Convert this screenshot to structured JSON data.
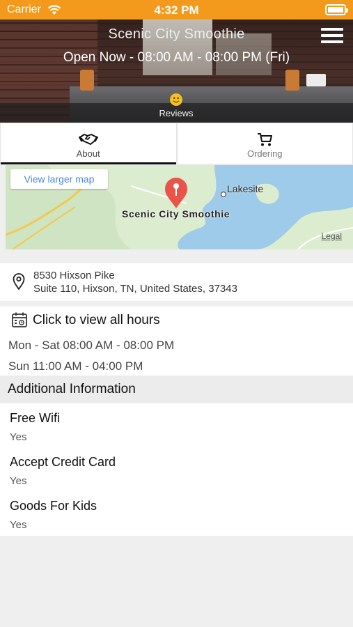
{
  "status_bar": {
    "carrier": "Carrier",
    "time": "4:32 PM"
  },
  "header": {
    "title": "Scenic City Smoothie",
    "open_status": "Open Now - 08:00 AM - 08:00 PM (Fri)",
    "reviews_label": "Reviews"
  },
  "tabs": [
    {
      "label": "About",
      "icon": "handshake-icon",
      "active": true
    },
    {
      "label": "Ordering",
      "icon": "cart-icon",
      "active": false
    }
  ],
  "map": {
    "view_larger": "View larger map",
    "place_label": "Scenic City Smoothie",
    "town_label": "Lakesite",
    "legal": "Legal"
  },
  "address": {
    "line1": "8530 Hixson Pike",
    "line2": "Suite 110, Hixson, TN, United States, 37343"
  },
  "hours": {
    "view_all": "Click to view all hours",
    "rows": [
      "Mon - Sat 08:00 AM - 08:00 PM",
      "Sun 11:00 AM - 04:00 PM"
    ]
  },
  "additional_info": {
    "heading": "Additional Information",
    "items": [
      {
        "label": "Free Wifi",
        "value": "Yes"
      },
      {
        "label": "Accept Credit Card",
        "value": "Yes"
      },
      {
        "label": "Goods For Kids",
        "value": "Yes"
      }
    ]
  },
  "colors": {
    "status_bar": "#f39a1c",
    "map_pin": "#e9534a",
    "link": "#4a88da"
  }
}
